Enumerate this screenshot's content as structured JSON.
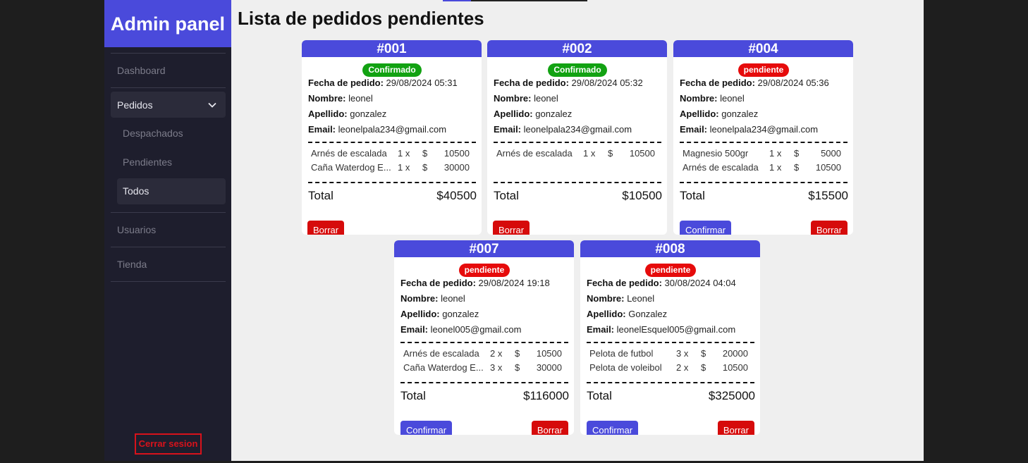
{
  "sidebar": {
    "brand": "Admin panel",
    "items": [
      {
        "label": "Dashboard"
      },
      {
        "label": "Pedidos"
      },
      {
        "label": "Usuarios"
      },
      {
        "label": "Tienda"
      }
    ],
    "sub_items": [
      {
        "label": "Despachados"
      },
      {
        "label": "Pendientes"
      },
      {
        "label": "Todos"
      }
    ],
    "logout_label": "Cerrar sesion"
  },
  "main": {
    "title": "Lista de pedidos pendientes"
  },
  "labels": {
    "date": "Fecha de pedido:",
    "name": "Nombre:",
    "surname": "Apellido:",
    "email": "Email:",
    "total": "Total",
    "confirm": "Confirmar",
    "delete": "Borrar"
  },
  "orders": [
    {
      "id": "#001",
      "status": "Confirmado",
      "date": "29/08/2024 05:31",
      "name": "leonel",
      "surname": "gonzalez",
      "email": "leonelpala234@gmail.com",
      "items": [
        {
          "name": "Arnés de escalada",
          "qty": "1 x",
          "cur": "$",
          "price": "10500"
        },
        {
          "name": "Caña Waterdog E...",
          "qty": "1 x",
          "cur": "$",
          "price": "30000"
        }
      ],
      "total": "$40500"
    },
    {
      "id": "#002",
      "status": "Confirmado",
      "date": "29/08/2024 05:32",
      "name": "leonel",
      "surname": "gonzalez",
      "email": "leonelpala234@gmail.com",
      "items": [
        {
          "name": "Arnés de escalada",
          "qty": "1 x",
          "cur": "$",
          "price": "10500"
        }
      ],
      "total": "$10500"
    },
    {
      "id": "#004",
      "status": "pendiente",
      "date": "29/08/2024 05:36",
      "name": "leonel",
      "surname": "gonzalez",
      "email": "leonelpala234@gmail.com",
      "items": [
        {
          "name": "Magnesio 500gr",
          "qty": "1 x",
          "cur": "$",
          "price": "5000"
        },
        {
          "name": "Arnés de escalada",
          "qty": "1 x",
          "cur": "$",
          "price": "10500"
        }
      ],
      "total": "$15500"
    },
    {
      "id": "#007",
      "status": "pendiente",
      "date": "29/08/2024 19:18",
      "name": "leonel",
      "surname": "gonzalez",
      "email": "leonel005@gmail.com",
      "items": [
        {
          "name": "Arnés de escalada",
          "qty": "2 x",
          "cur": "$",
          "price": "10500"
        },
        {
          "name": "Caña Waterdog E...",
          "qty": "3 x",
          "cur": "$",
          "price": "30000"
        }
      ],
      "total": "$116000"
    },
    {
      "id": "#008",
      "status": "pendiente",
      "date": "30/08/2024 04:04",
      "name": "Leonel",
      "surname": "Gonzalez",
      "email": "leonelEsquel005@gmail.com",
      "items": [
        {
          "name": "Pelota de futbol",
          "qty": "3 x",
          "cur": "$",
          "price": "20000"
        },
        {
          "name": "Pelota de voleibol",
          "qty": "2 x",
          "cur": "$",
          "price": "10500"
        }
      ],
      "total": "$325000"
    }
  ],
  "colors": {
    "accent": "#4a4adb",
    "confirmed": "#12a212",
    "pending": "#e60b0b",
    "danger": "#d60b0b",
    "sidebar_bg": "#1e1e2d"
  }
}
